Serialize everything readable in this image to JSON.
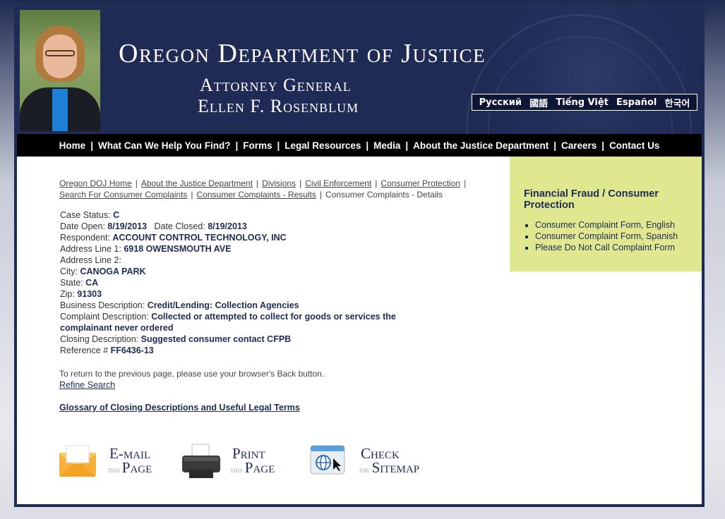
{
  "header": {
    "org_title": "Oregon Department of Justice",
    "ag_title": "Attorney General",
    "ag_name": "Ellen F. Rosenblum",
    "languages": [
      "Русский",
      "國語",
      "Tiếng Việt",
      "Español",
      "한국어"
    ]
  },
  "nav": {
    "items": [
      "Home",
      "What Can We Help You Find?",
      "Forms",
      "Legal Resources",
      "Media",
      "About the Justice Department",
      "Careers",
      "Contact Us"
    ]
  },
  "breadcrumb": {
    "links": [
      "Oregon DOJ Home",
      "About the Justice Department",
      "Divisions",
      "Civil Enforcement",
      "Consumer Protection",
      "Search For Consumer Complaints",
      "Consumer Complaints - Results"
    ],
    "current": "Consumer Complaints - Details"
  },
  "details": {
    "case_status_label": "Case Status:",
    "case_status": "C",
    "date_open_label": "Date Open:",
    "date_open": "8/19/2013",
    "date_closed_label": "Date Closed:",
    "date_closed": "8/19/2013",
    "respondent_label": "Respondent:",
    "respondent": "ACCOUNT CONTROL TECHNOLOGY, INC",
    "address1_label": "Address Line 1:",
    "address1": "6918 OWENSMOUTH AVE",
    "address2_label": "Address Line 2:",
    "address2": "",
    "city_label": "City:",
    "city": "CANOGA PARK",
    "state_label": "State:",
    "state": "CA",
    "zip_label": "Zip:",
    "zip": "91303",
    "business_label": "Business Description:",
    "business": "Credit/Lending: Collection Agencies",
    "complaint_label": "Complaint Description:",
    "complaint": "Collected or attempted to collect for goods or services the complainant never ordered",
    "closing_label": "Closing Description:",
    "closing": "Suggested consumer contact CFPB",
    "reference_label": "Reference #",
    "reference": "FF6436-13"
  },
  "back_note": "To return to the previous page, please use your browser's Back button.",
  "refine_link": "Refine Search",
  "glossary_link": "Glossary of Closing Descriptions and Useful Legal Terms",
  "actions": {
    "email": {
      "l1": "E-mail",
      "small": "this",
      "l2": "Page"
    },
    "print": {
      "l1": "Print",
      "small": "this",
      "l2": "Page"
    },
    "sitemap": {
      "l1": "Check",
      "small": "the",
      "l2": "Sitemap"
    }
  },
  "sidebar": {
    "title": "Financial Fraud / Consumer Protection",
    "links": [
      "Consumer Complaint Form, English",
      "Consumer Complaint Form, Spanish",
      "Please Do Not Call Complaint Form"
    ]
  },
  "colors": {
    "navy": "#1f2b55",
    "sidebar_bg": "#dfe78f",
    "nav_bg": "#000000"
  }
}
